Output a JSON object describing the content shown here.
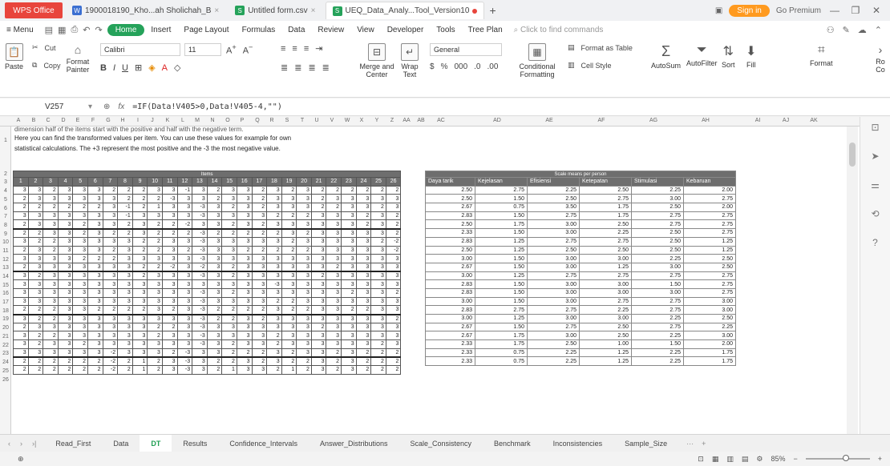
{
  "titlebar": {
    "app_name": "WPS Office",
    "tabs": [
      {
        "label": "1900018190_Kho...ah Sholichah_B",
        "icon": "word-icon",
        "color": "#3b6fd1",
        "active": false
      },
      {
        "label": "Untitled form.csv",
        "icon": "sheet-icon",
        "color": "#25a25a",
        "active": false
      },
      {
        "label": "UEQ_Data_Analy...Tool_Version10",
        "icon": "sheet-icon",
        "color": "#25a25a",
        "active": true
      }
    ],
    "signin_label": "Sign in",
    "go_premium": "Go Premium"
  },
  "menubar": {
    "menu": "Menu",
    "items": [
      "Home",
      "Insert",
      "Page Layout",
      "Formulas",
      "Data",
      "Review",
      "View",
      "Developer",
      "Tools",
      "Tree Plan"
    ],
    "search_placeholder": "Click to find commands"
  },
  "ribbon": {
    "paste": "Paste",
    "cut": "Cut",
    "copy": "Copy",
    "format_painter": "Format Painter",
    "font_name": "Calibri",
    "font_size": "11",
    "merge_center": "Merge and Center",
    "wrap_text": "Wrap Text",
    "number_format": "General",
    "conditional_formatting": "Conditional Formatting",
    "format_as_table": "Format as Table",
    "cell_style": "Cell Style",
    "autosum": "AutoSum",
    "autofilter": "AutoFilter",
    "sort": "Sort",
    "fill": "Fill",
    "format": "Format",
    "row_col": "Ro Co"
  },
  "formula_bar": {
    "cell_ref": "V257",
    "formula": "=IF(Data!V405>0,Data!V405-4,\"\")"
  },
  "sheet": {
    "column_letters": [
      "A",
      "B",
      "C",
      "D",
      "E",
      "F",
      "G",
      "H",
      "I",
      "J",
      "K",
      "L",
      "M",
      "N",
      "O",
      "P",
      "Q",
      "R",
      "S",
      "T",
      "U",
      "V",
      "W",
      "X",
      "Y",
      "Z",
      "AA",
      "AB",
      "AC",
      "AD",
      "AE",
      "AF",
      "AG",
      "AH",
      "AI",
      "AJ",
      "AK"
    ],
    "row_numbers": [
      "1",
      "2",
      "3",
      "4",
      "5",
      "6",
      "7",
      "8",
      "9",
      "10",
      "11",
      "12",
      "13",
      "14",
      "15",
      "16",
      "17",
      "18",
      "19",
      "20",
      "21",
      "22",
      "23",
      "24",
      "25",
      "26"
    ],
    "note_line0": "dimension half of the items start with the positive and half with the negative term.",
    "note_line1": "Here you can find the transformed values per item. You can use these values for example for own",
    "note_line2": "statistical calculations. The +3 represent the most positive and the -3 the most negative value.",
    "items_caption": "Items",
    "item_numbers": [
      "1",
      "2",
      "3",
      "4",
      "5",
      "6",
      "7",
      "8",
      "9",
      "10",
      "11",
      "12",
      "13",
      "14",
      "15",
      "16",
      "17",
      "18",
      "19",
      "20",
      "21",
      "22",
      "23",
      "24",
      "25",
      "26"
    ],
    "items_rows": [
      [
        "3",
        "3",
        "2",
        "3",
        "3",
        "3",
        "2",
        "2",
        "2",
        "3",
        "3",
        "-1",
        "3",
        "2",
        "3",
        "3",
        "2",
        "3",
        "2",
        "3",
        "2",
        "2",
        "2",
        "2",
        "2",
        "2"
      ],
      [
        "2",
        "3",
        "3",
        "3",
        "3",
        "3",
        "3",
        "2",
        "2",
        "2",
        "-3",
        "3",
        "3",
        "2",
        "3",
        "3",
        "2",
        "3",
        "3",
        "3",
        "2",
        "3",
        "3",
        "3",
        "3",
        "3"
      ],
      [
        "2",
        "2",
        "2",
        "2",
        "2",
        "2",
        "3",
        "-1",
        "2",
        "1",
        "3",
        "3",
        "-3",
        "3",
        "2",
        "3",
        "2",
        "3",
        "3",
        "3",
        "2",
        "2",
        "3",
        "3",
        "2",
        "3"
      ],
      [
        "3",
        "3",
        "3",
        "3",
        "3",
        "3",
        "3",
        "-1",
        "3",
        "3",
        "3",
        "3",
        "-3",
        "3",
        "3",
        "3",
        "3",
        "2",
        "2",
        "2",
        "3",
        "3",
        "3",
        "2",
        "3",
        "2"
      ],
      [
        "2",
        "3",
        "3",
        "3",
        "2",
        "3",
        "3",
        "2",
        "3",
        "2",
        "2",
        "-2",
        "3",
        "3",
        "2",
        "3",
        "2",
        "3",
        "3",
        "3",
        "3",
        "3",
        "3",
        "2",
        "3",
        "2"
      ],
      [
        "2",
        "2",
        "3",
        "3",
        "2",
        "3",
        "2",
        "2",
        "3",
        "2",
        "2",
        "2",
        "-3",
        "2",
        "2",
        "2",
        "2",
        "2",
        "3",
        "2",
        "3",
        "3",
        "3",
        "3",
        "3",
        "2"
      ],
      [
        "3",
        "2",
        "2",
        "3",
        "3",
        "3",
        "3",
        "3",
        "2",
        "2",
        "3",
        "3",
        "-3",
        "3",
        "3",
        "3",
        "3",
        "3",
        "2",
        "3",
        "3",
        "3",
        "3",
        "3",
        "2",
        "-2"
      ],
      [
        "2",
        "3",
        "2",
        "3",
        "3",
        "3",
        "2",
        "3",
        "2",
        "2",
        "3",
        "2",
        "-3",
        "3",
        "3",
        "2",
        "2",
        "2",
        "2",
        "2",
        "3",
        "3",
        "3",
        "3",
        "3",
        "-2"
      ],
      [
        "3",
        "3",
        "3",
        "3",
        "2",
        "2",
        "2",
        "3",
        "3",
        "3",
        "3",
        "3",
        "-3",
        "3",
        "3",
        "3",
        "3",
        "3",
        "3",
        "3",
        "3",
        "3",
        "3",
        "3",
        "3",
        "3"
      ],
      [
        "2",
        "3",
        "3",
        "3",
        "3",
        "3",
        "3",
        "3",
        "2",
        "2",
        "-2",
        "3",
        "-2",
        "3",
        "2",
        "3",
        "3",
        "3",
        "3",
        "3",
        "3",
        "2",
        "3",
        "3",
        "3",
        "3"
      ],
      [
        "3",
        "2",
        "3",
        "3",
        "3",
        "3",
        "3",
        "3",
        "2",
        "3",
        "3",
        "3",
        "-3",
        "3",
        "2",
        "3",
        "3",
        "3",
        "3",
        "3",
        "2",
        "3",
        "3",
        "3",
        "3",
        "3"
      ],
      [
        "3",
        "3",
        "3",
        "3",
        "3",
        "3",
        "3",
        "3",
        "3",
        "3",
        "3",
        "3",
        "3",
        "3",
        "3",
        "3",
        "3",
        "-3",
        "3",
        "3",
        "3",
        "3",
        "3",
        "3",
        "3",
        "3"
      ],
      [
        "3",
        "3",
        "3",
        "3",
        "3",
        "3",
        "3",
        "3",
        "3",
        "3",
        "3",
        "3",
        "-3",
        "3",
        "2",
        "3",
        "3",
        "3",
        "3",
        "3",
        "3",
        "3",
        "2",
        "3",
        "3",
        "2"
      ],
      [
        "3",
        "3",
        "3",
        "3",
        "3",
        "3",
        "3",
        "3",
        "3",
        "3",
        "3",
        "3",
        "-3",
        "3",
        "3",
        "3",
        "3",
        "2",
        "2",
        "3",
        "3",
        "3",
        "3",
        "3",
        "3",
        "3"
      ],
      [
        "2",
        "2",
        "2",
        "3",
        "3",
        "2",
        "2",
        "2",
        "2",
        "3",
        "2",
        "3",
        "-3",
        "2",
        "2",
        "2",
        "2",
        "3",
        "2",
        "2",
        "3",
        "3",
        "2",
        "2",
        "3",
        "3"
      ],
      [
        "3",
        "2",
        "2",
        "3",
        "3",
        "3",
        "3",
        "3",
        "3",
        "3",
        "3",
        "3",
        "-3",
        "2",
        "2",
        "3",
        "2",
        "3",
        "3",
        "3",
        "3",
        "3",
        "3",
        "3",
        "3",
        "2"
      ],
      [
        "2",
        "3",
        "3",
        "3",
        "3",
        "3",
        "3",
        "3",
        "3",
        "2",
        "2",
        "3",
        "-3",
        "3",
        "3",
        "3",
        "3",
        "3",
        "3",
        "3",
        "2",
        "3",
        "3",
        "3",
        "3",
        "3"
      ],
      [
        "3",
        "2",
        "2",
        "3",
        "3",
        "3",
        "3",
        "3",
        "3",
        "2",
        "3",
        "3",
        "-3",
        "3",
        "3",
        "3",
        "3",
        "2",
        "3",
        "3",
        "3",
        "3",
        "3",
        "3",
        "3",
        "3"
      ],
      [
        "3",
        "2",
        "3",
        "3",
        "2",
        "3",
        "3",
        "3",
        "3",
        "3",
        "3",
        "3",
        "-3",
        "3",
        "2",
        "3",
        "3",
        "2",
        "3",
        "3",
        "3",
        "3",
        "3",
        "3",
        "2",
        "3"
      ],
      [
        "3",
        "3",
        "3",
        "3",
        "3",
        "3",
        "-2",
        "3",
        "3",
        "3",
        "2",
        "-3",
        "3",
        "3",
        "2",
        "2",
        "2",
        "3",
        "2",
        "3",
        "3",
        "2",
        "3",
        "2",
        "2",
        "2"
      ],
      [
        "2",
        "2",
        "2",
        "2",
        "2",
        "2",
        "-2",
        "2",
        "1",
        "2",
        "3",
        "-3",
        "3",
        "2",
        "2",
        "3",
        "2",
        "3",
        "2",
        "2",
        "3",
        "2",
        "3",
        "2",
        "2",
        "2"
      ],
      [
        "2",
        "2",
        "2",
        "2",
        "2",
        "2",
        "-2",
        "2",
        "1",
        "2",
        "3",
        "-3",
        "3",
        "2",
        "1",
        "3",
        "3",
        "2",
        "1",
        "2",
        "3",
        "2",
        "3",
        "2",
        "2",
        "2"
      ]
    ],
    "means_caption": "Scale means per person",
    "means_headers": [
      "Daya tarik",
      "Kejelasan",
      "Efisiensi",
      "Ketepatan",
      "Stimulasi",
      "Kebaruan"
    ],
    "means_rows": [
      [
        "2.50",
        "2.75",
        "2.25",
        "2.50",
        "2.25",
        "2.00"
      ],
      [
        "2.50",
        "1.50",
        "2.50",
        "2.75",
        "3.00",
        "2.75"
      ],
      [
        "2.67",
        "0.75",
        "3.50",
        "1.75",
        "2.50",
        "2.00"
      ],
      [
        "2.83",
        "1.50",
        "2.75",
        "1.75",
        "2.75",
        "2.75"
      ],
      [
        "2.50",
        "1.75",
        "3.00",
        "2.50",
        "2.75",
        "2.75"
      ],
      [
        "2.33",
        "1.50",
        "3.00",
        "2.25",
        "2.50",
        "2.75"
      ],
      [
        "2.83",
        "1.25",
        "2.75",
        "2.75",
        "2.50",
        "1.25"
      ],
      [
        "2.50",
        "1.25",
        "2.50",
        "2.50",
        "2.50",
        "1.25"
      ],
      [
        "3.00",
        "1.50",
        "3.00",
        "3.00",
        "2.25",
        "2.50"
      ],
      [
        "2.67",
        "1.50",
        "3.00",
        "1.25",
        "3.00",
        "2.50"
      ],
      [
        "3.00",
        "1.25",
        "2.75",
        "2.75",
        "2.75",
        "2.75"
      ],
      [
        "2.83",
        "1.50",
        "3.00",
        "3.00",
        "1.50",
        "2.75"
      ],
      [
        "2.83",
        "1.50",
        "3.00",
        "3.00",
        "3.00",
        "2.75"
      ],
      [
        "3.00",
        "1.50",
        "3.00",
        "2.75",
        "2.75",
        "3.00"
      ],
      [
        "2.83",
        "2.75",
        "2.75",
        "2.25",
        "2.75",
        "3.00"
      ],
      [
        "3.00",
        "1.25",
        "3.00",
        "3.00",
        "2.25",
        "2.50"
      ],
      [
        "2.67",
        "1.50",
        "2.75",
        "2.50",
        "2.75",
        "2.25"
      ],
      [
        "2.67",
        "1.75",
        "3.00",
        "2.50",
        "2.25",
        "3.00"
      ],
      [
        "2.33",
        "1.75",
        "2.50",
        "1.00",
        "1.50",
        "2.00"
      ],
      [
        "2.33",
        "0.75",
        "2.25",
        "1.25",
        "2.25",
        "1.75"
      ],
      [
        "2.33",
        "0.75",
        "2.25",
        "1.25",
        "2.25",
        "1.75"
      ]
    ]
  },
  "sheet_tabs": {
    "tabs": [
      "Read_First",
      "Data",
      "DT",
      "Results",
      "Confidence_Intervals",
      "Answer_Distributions",
      "Scale_Consistency",
      "Benchmark",
      "Inconsistencies",
      "Sample_Size"
    ],
    "active": "DT",
    "more": "···"
  },
  "statusbar": {
    "zoom": "85%"
  }
}
